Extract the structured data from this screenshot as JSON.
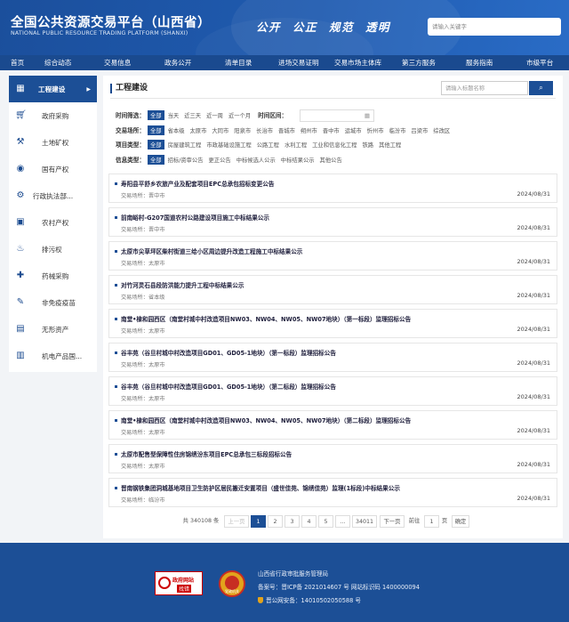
{
  "header": {
    "title": "全国公共资源交易平台（山西省）",
    "subtitle": "NATIONAL PUBLIC RESOURCE TRADING PLATFORM (SHANXI)",
    "slogans": [
      "公开",
      "公正",
      "规范",
      "透明"
    ],
    "search_placeholder": "请输入关键字"
  },
  "nav": [
    "首页",
    "综合动态",
    "交易信息",
    "政务公开",
    "清单目录",
    "进场交易证明",
    "交易市场主体库",
    "第三方服务",
    "服务指南",
    "市级平台"
  ],
  "sidebar": {
    "items": [
      {
        "label": "工程建设",
        "icon": "construction-icon",
        "active": true
      },
      {
        "label": "政府采购",
        "icon": "cart-icon"
      },
      {
        "label": "土地矿权",
        "icon": "pickaxe-icon"
      },
      {
        "label": "国有产权",
        "icon": "property-icon"
      },
      {
        "label": "行政执法部...",
        "icon": "law-icon"
      },
      {
        "label": "农村产权",
        "icon": "farm-icon"
      },
      {
        "label": "排污权",
        "icon": "emission-icon"
      },
      {
        "label": "药械采购",
        "icon": "medicine-icon"
      },
      {
        "label": "非免疫疫苗",
        "icon": "vaccine-icon"
      },
      {
        "label": "无形资产",
        "icon": "asset-icon"
      },
      {
        "label": "机电产品国...",
        "icon": "machine-icon"
      }
    ]
  },
  "main": {
    "title": "工程建设",
    "search_placeholder": "请输入标题名称",
    "filters": {
      "time": {
        "label": "时间筛选：",
        "options": [
          "全部",
          "当天",
          "近三天",
          "近一周",
          "近一个月"
        ],
        "range_label": "时间区间："
      },
      "place": {
        "label": "交易场所：",
        "options": [
          "全部",
          "省本级",
          "太原市",
          "大同市",
          "阳泉市",
          "长治市",
          "晋城市",
          "朔州市",
          "晋中市",
          "运城市",
          "忻州市",
          "临汾市",
          "吕梁市",
          "综改区"
        ]
      },
      "type": {
        "label": "项目类型：",
        "options": [
          "全部",
          "房屋建筑工程",
          "市政基础设施工程",
          "公路工程",
          "水利工程",
          "工业和信息化工程",
          "铁路",
          "其他工程"
        ]
      },
      "info": {
        "label": "信息类型：",
        "options": [
          "全部",
          "招标/资审公告",
          "更正公告",
          "中标候选人公示",
          "中标结果公示",
          "其他公告"
        ]
      }
    },
    "location_prefix": "交易场所：",
    "items": [
      {
        "title": "寿阳县平舒乡农旅产业及配套项目EPC总承包招标变更公告",
        "location": "晋中市",
        "date": "2024/08/31"
      },
      {
        "title": "前南峪村-G207国道农村公路建设项目施工中标结果公示",
        "location": "晋中市",
        "date": "2024/08/31"
      },
      {
        "title": "太原市尖草坪区柴村街道三给小区周边提升改造工程施工中标结果公示",
        "location": "太原市",
        "date": "2024/08/31"
      },
      {
        "title": "对竹河灵石县段防洪能力提升工程中标结果公示",
        "location": "省本级",
        "date": "2024/08/31"
      },
      {
        "title": "南堂•棣和园西区（南堂村城中村改造项目NW03、NW04、NW05、NW07地块）（第一标段）监理招标公告",
        "location": "太原市",
        "date": "2024/08/31"
      },
      {
        "title": "谷丰苑（谷旦村城中村改造项目GD01、GD05-1地块）（第一标段）监理招标公告",
        "location": "太原市",
        "date": "2024/08/31"
      },
      {
        "title": "谷丰苑（谷旦村城中村改造项目GD01、GD05-1地块）（第二标段）监理招标公告",
        "location": "太原市",
        "date": "2024/08/31"
      },
      {
        "title": "南堂•棣和园西区（南堂村城中村改造项目NW03、NW04、NW05、NW07地块）（第二标段）监理招标公告",
        "location": "太原市",
        "date": "2024/08/31"
      },
      {
        "title": "太原市配售型保障性住房锦绣汾东项目EPC总承包三标段招标公告",
        "location": "太原市",
        "date": "2024/08/31"
      },
      {
        "title": "晋南钢铁集团洞城基地项目卫生防护区居民搬迁安置项目（盛世佳苑、锦绣佳苑）监理(1标段)中标结果公示",
        "location": "临汾市",
        "date": "2024/08/31"
      }
    ],
    "pager": {
      "total": "共 340108 条",
      "prev": "上一页",
      "pages": [
        "1",
        "2",
        "3",
        "4",
        "5",
        "...",
        "34011"
      ],
      "current": "1",
      "next": "下一页",
      "goto_label": "前往",
      "goto_value": "1",
      "page_suffix": "页",
      "confirm": "确定"
    }
  },
  "footer": {
    "gov_badge_title": "政府网站",
    "gov_badge_action": "找错",
    "police_badge_text": "党政机关",
    "org": "山西省行政审批服务管理局",
    "icp": "备案号：晋ICP备 2021014607 号  网站标识码 1400000094",
    "police": "晋公网安备：14010502050588 号"
  }
}
